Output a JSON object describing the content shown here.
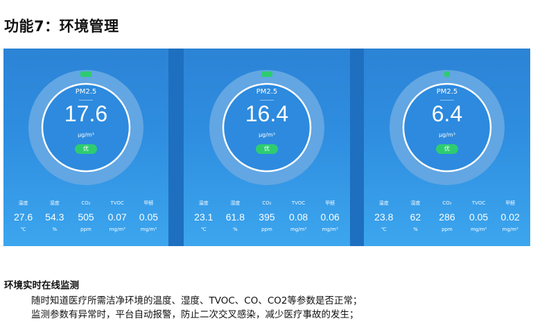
{
  "heading": "功能7：环境管理",
  "panels": [
    {
      "gauge_label": "PM2.5",
      "gauge_value": "17.6",
      "gauge_unit": "μg/m³",
      "badge": "优",
      "metrics": [
        {
          "name": "温度",
          "value": "27.6",
          "unit": "℃"
        },
        {
          "name": "湿度",
          "value": "54.3",
          "unit": "%"
        },
        {
          "name": "CO₂",
          "value": "505",
          "unit": "ppm"
        },
        {
          "name": "TVOC",
          "value": "0.07",
          "unit": "mg/m³"
        },
        {
          "name": "甲醛",
          "value": "0.05",
          "unit": "mg/m³"
        }
      ]
    },
    {
      "gauge_label": "PM2.5",
      "gauge_value": "16.4",
      "gauge_unit": "μg/m³",
      "badge": "优",
      "metrics": [
        {
          "name": "温度",
          "value": "23.1",
          "unit": "℃"
        },
        {
          "name": "湿度",
          "value": "61.8",
          "unit": "%"
        },
        {
          "name": "CO₂",
          "value": "395",
          "unit": "ppm"
        },
        {
          "name": "TVOC",
          "value": "0.08",
          "unit": "mg/m³"
        },
        {
          "name": "甲醛",
          "value": "0.06",
          "unit": "mg/m³"
        }
      ]
    },
    {
      "gauge_label": "PM2.5",
      "gauge_value": "6.4",
      "gauge_unit": "μg/m³",
      "badge": "优",
      "metrics": [
        {
          "name": "温度",
          "value": "23.8",
          "unit": "℃"
        },
        {
          "name": "湿度",
          "value": "62",
          "unit": "%"
        },
        {
          "name": "CO₂",
          "value": "286",
          "unit": "ppm"
        },
        {
          "name": "TVOC",
          "value": "0.05",
          "unit": "mg/m³"
        },
        {
          "name": "甲醛",
          "value": "0.02",
          "unit": "mg/m³"
        }
      ]
    }
  ],
  "section_title": "环境实时在线监测",
  "descriptions": [
    "随时知道医疗所需洁净环境的温度、湿度、TVOC、CO、CO2等参数是否正常；",
    "监测参数有异常时，平台自动报警，防止二次交叉感染，减少医疗事故的发生；"
  ],
  "colors": {
    "panel_top": "#2c83d6",
    "panel_bottom": "#3ca6ee",
    "gauge_ring": "#62a6e3",
    "gauge_inner_border": "#ffffff",
    "indicator": "#2ecc71",
    "badge": "#2ecc71"
  }
}
